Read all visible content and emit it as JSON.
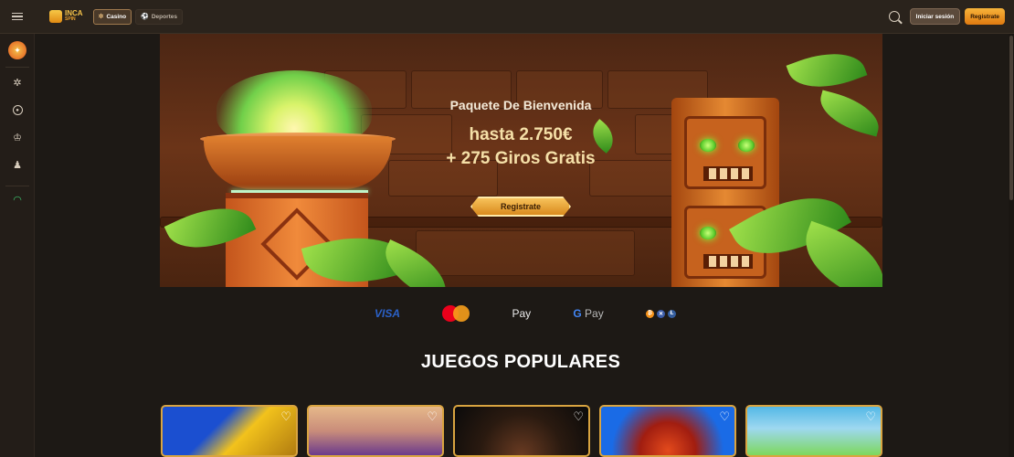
{
  "brand": {
    "line1": "INCA",
    "line2": "SPIN"
  },
  "header": {
    "nav": [
      {
        "label": "Casino",
        "icon": "casino-chip-icon",
        "active": true
      },
      {
        "label": "Deportes",
        "icon": "sports-ball-icon",
        "active": false
      }
    ],
    "search_icon": "search-icon",
    "login_label": "Iniciar sesión",
    "register_label": "Registrate"
  },
  "sidebar": {
    "items": [
      {
        "icon": "promo-gift-icon"
      },
      {
        "icon": "casino-chip-icon"
      },
      {
        "icon": "live-casino-icon"
      },
      {
        "icon": "table-games-icon"
      },
      {
        "icon": "crash-games-icon"
      },
      {
        "icon": "support-headset-icon"
      }
    ]
  },
  "banner": {
    "subtitle": "Paquete De Bienvenida",
    "amount": "hasta 2.750€",
    "spins": "+ 275 Giros Gratis",
    "cta_label": "Registrate"
  },
  "payments": {
    "visa": "VISA",
    "apple_pay": "Pay",
    "google_pay_g": "G",
    "google_pay": "Pay"
  },
  "popular": {
    "title": "JUEGOS POPULARES",
    "cards": [
      {
        "name": "game-1",
        "colors": [
          "#1b4fd0",
          "#f2c21c"
        ]
      },
      {
        "name": "game-2",
        "colors": [
          "#e6b88a",
          "#6b3a8c"
        ]
      },
      {
        "name": "game-3",
        "colors": [
          "#0a0a0a",
          "#6a3b22"
        ]
      },
      {
        "name": "game-4",
        "colors": [
          "#1a6be6",
          "#e34a1c"
        ]
      },
      {
        "name": "game-5",
        "colors": [
          "#54b8e6",
          "#7dd85c"
        ]
      }
    ]
  },
  "colors": {
    "accent": "#f0a22e",
    "background": "#1d1915",
    "card_border": "#d9a440"
  }
}
